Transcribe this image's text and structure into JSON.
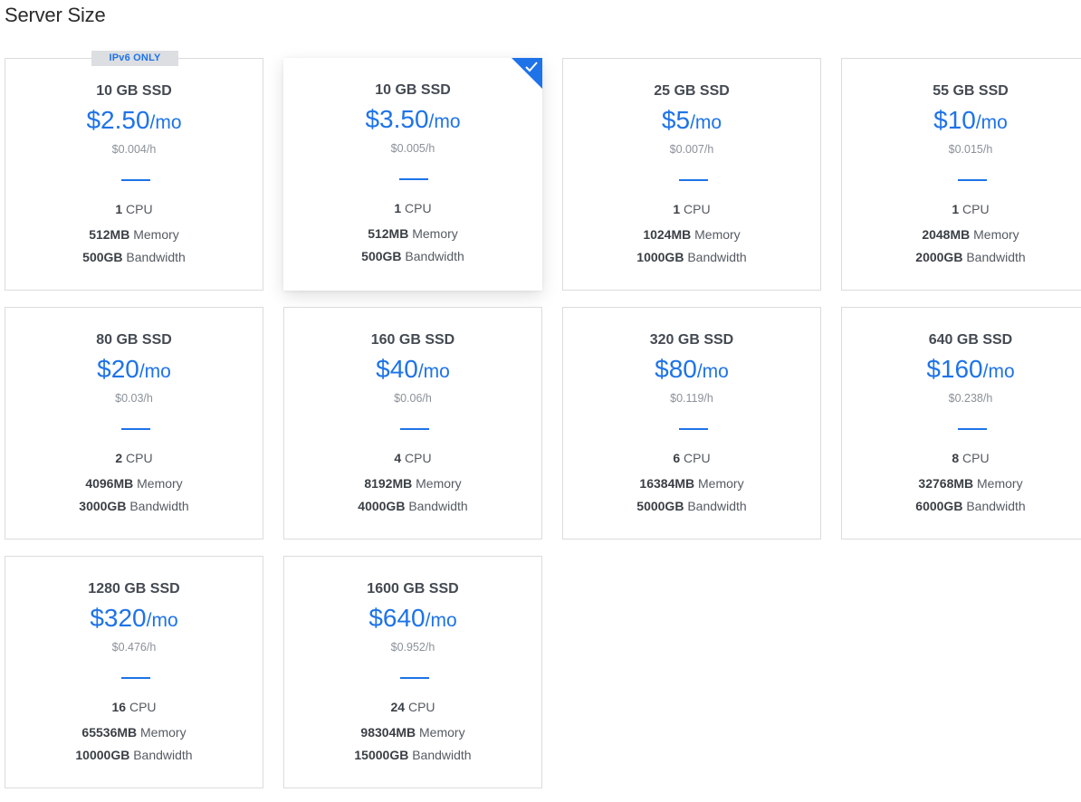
{
  "page": {
    "title": "Server Size"
  },
  "colors": {
    "accent": "#1e73e8",
    "badge_bg": "#dcdee2",
    "border": "#dcdcdc"
  },
  "plans": [
    {
      "storage": "10 GB SSD",
      "price": "$2.50",
      "per": "/mo",
      "hourly": "$0.004/h",
      "cpu": "1",
      "cpu_label": " CPU",
      "memory": "512MB",
      "memory_label": " Memory",
      "bandwidth": "500GB",
      "bandwidth_label": " Bandwidth",
      "badge": "IPv6 ONLY",
      "selected": false
    },
    {
      "storage": "10 GB SSD",
      "price": "$3.50",
      "per": "/mo",
      "hourly": "$0.005/h",
      "cpu": "1",
      "cpu_label": " CPU",
      "memory": "512MB",
      "memory_label": " Memory",
      "bandwidth": "500GB",
      "bandwidth_label": " Bandwidth",
      "selected": true,
      "selected_icon": "checkmark-icon"
    },
    {
      "storage": "25 GB SSD",
      "price": "$5",
      "per": "/mo",
      "hourly": "$0.007/h",
      "cpu": "1",
      "cpu_label": " CPU",
      "memory": "1024MB",
      "memory_label": " Memory",
      "bandwidth": "1000GB",
      "bandwidth_label": " Bandwidth",
      "selected": false
    },
    {
      "storage": "55 GB SSD",
      "price": "$10",
      "per": "/mo",
      "hourly": "$0.015/h",
      "cpu": "1",
      "cpu_label": " CPU",
      "memory": "2048MB",
      "memory_label": " Memory",
      "bandwidth": "2000GB",
      "bandwidth_label": " Bandwidth",
      "selected": false
    },
    {
      "storage": "80 GB SSD",
      "price": "$20",
      "per": "/mo",
      "hourly": "$0.03/h",
      "cpu": "2",
      "cpu_label": " CPU",
      "memory": "4096MB",
      "memory_label": " Memory",
      "bandwidth": "3000GB",
      "bandwidth_label": " Bandwidth",
      "selected": false
    },
    {
      "storage": "160 GB SSD",
      "price": "$40",
      "per": "/mo",
      "hourly": "$0.06/h",
      "cpu": "4",
      "cpu_label": " CPU",
      "memory": "8192MB",
      "memory_label": " Memory",
      "bandwidth": "4000GB",
      "bandwidth_label": " Bandwidth",
      "selected": false
    },
    {
      "storage": "320 GB SSD",
      "price": "$80",
      "per": "/mo",
      "hourly": "$0.119/h",
      "cpu": "6",
      "cpu_label": " CPU",
      "memory": "16384MB",
      "memory_label": " Memory",
      "bandwidth": "5000GB",
      "bandwidth_label": " Bandwidth",
      "selected": false
    },
    {
      "storage": "640 GB SSD",
      "price": "$160",
      "per": "/mo",
      "hourly": "$0.238/h",
      "cpu": "8",
      "cpu_label": " CPU",
      "memory": "32768MB",
      "memory_label": " Memory",
      "bandwidth": "6000GB",
      "bandwidth_label": " Bandwidth",
      "selected": false
    },
    {
      "storage": "1280 GB SSD",
      "price": "$320",
      "per": "/mo",
      "hourly": "$0.476/h",
      "cpu": "16",
      "cpu_label": " CPU",
      "memory": "65536MB",
      "memory_label": " Memory",
      "bandwidth": "10000GB",
      "bandwidth_label": " Bandwidth",
      "selected": false
    },
    {
      "storage": "1600 GB SSD",
      "price": "$640",
      "per": "/mo",
      "hourly": "$0.952/h",
      "cpu": "24",
      "cpu_label": " CPU",
      "memory": "98304MB",
      "memory_label": " Memory",
      "bandwidth": "15000GB",
      "bandwidth_label": " Bandwidth",
      "selected": false
    }
  ]
}
